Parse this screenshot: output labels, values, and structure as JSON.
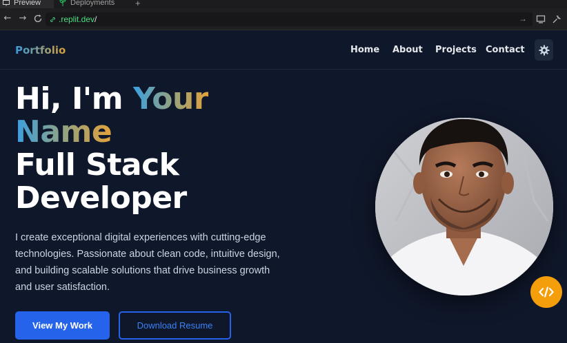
{
  "browser": {
    "tabs": [
      {
        "label": "Preview",
        "icon": "monitor-icon"
      },
      {
        "label": "Deployments",
        "icon": "sprout-icon"
      }
    ],
    "new_tab": "+",
    "url_host": ".replit.dev",
    "url_path": "/"
  },
  "site": {
    "brand": "Portfolio",
    "nav": [
      "Home",
      "About",
      "Projects",
      "Contact"
    ],
    "theme_toggle_icon": "gear-icon"
  },
  "hero": {
    "greeting": "Hi, I'm ",
    "name_line1": "Your",
    "name_line2": "Name",
    "role_line1": "Full Stack",
    "role_line2": "Developer",
    "description": "I create exceptional digital experiences with cutting-edge technologies. Passionate about clean code, intuitive design, and building scalable solutions that drive business growth and user satisfaction.",
    "primary_button": "View My Work",
    "secondary_button": "Download Resume",
    "badge_icon": "code-icon"
  },
  "colors": {
    "background": "#0f172a",
    "accent_blue": "#2563eb",
    "accent_orange": "#f59e0b"
  }
}
